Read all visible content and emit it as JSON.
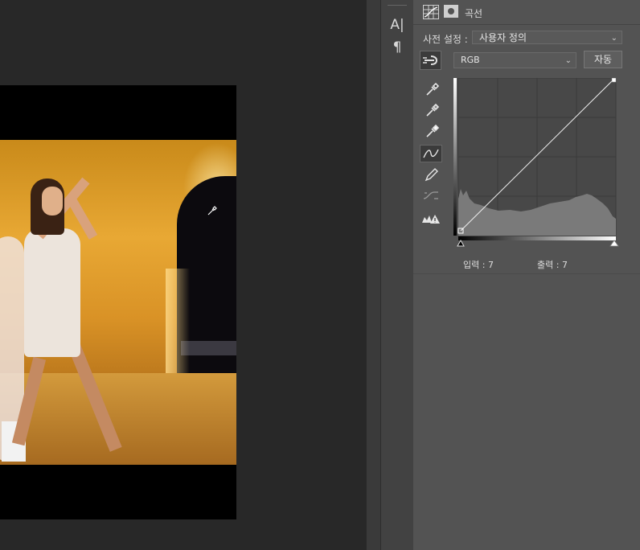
{
  "toolbar": {
    "type_tool_glyph": "A|",
    "paragraph_glyph": "¶"
  },
  "properties_panel": {
    "title": "곡선",
    "adjustment_icon": "curves-adjustment-icon",
    "mask_icon": "layer-mask-icon",
    "preset": {
      "label": "사전 설정 :",
      "value": "사용자 정의"
    },
    "channel": {
      "value": "RGB"
    },
    "auto_button": "자동",
    "readout": {
      "input": "입력 : 7",
      "output": "출력 : 7"
    },
    "side_tools": [
      "black-point-eyedropper-icon",
      "gray-point-eyedropper-icon",
      "white-point-eyedropper-icon",
      "curve-point-tool-icon",
      "pencil-draw-icon",
      "smooth-curve-icon",
      "clipping-warning-icon"
    ],
    "curve": {
      "points": [
        [
          7,
          7
        ],
        [
          255,
          255
        ]
      ],
      "range": [
        0,
        255
      ]
    }
  },
  "colors": {
    "panel_bg": "#535353",
    "canvas_bg": "#282828",
    "histogram": "#7a7a7a"
  }
}
